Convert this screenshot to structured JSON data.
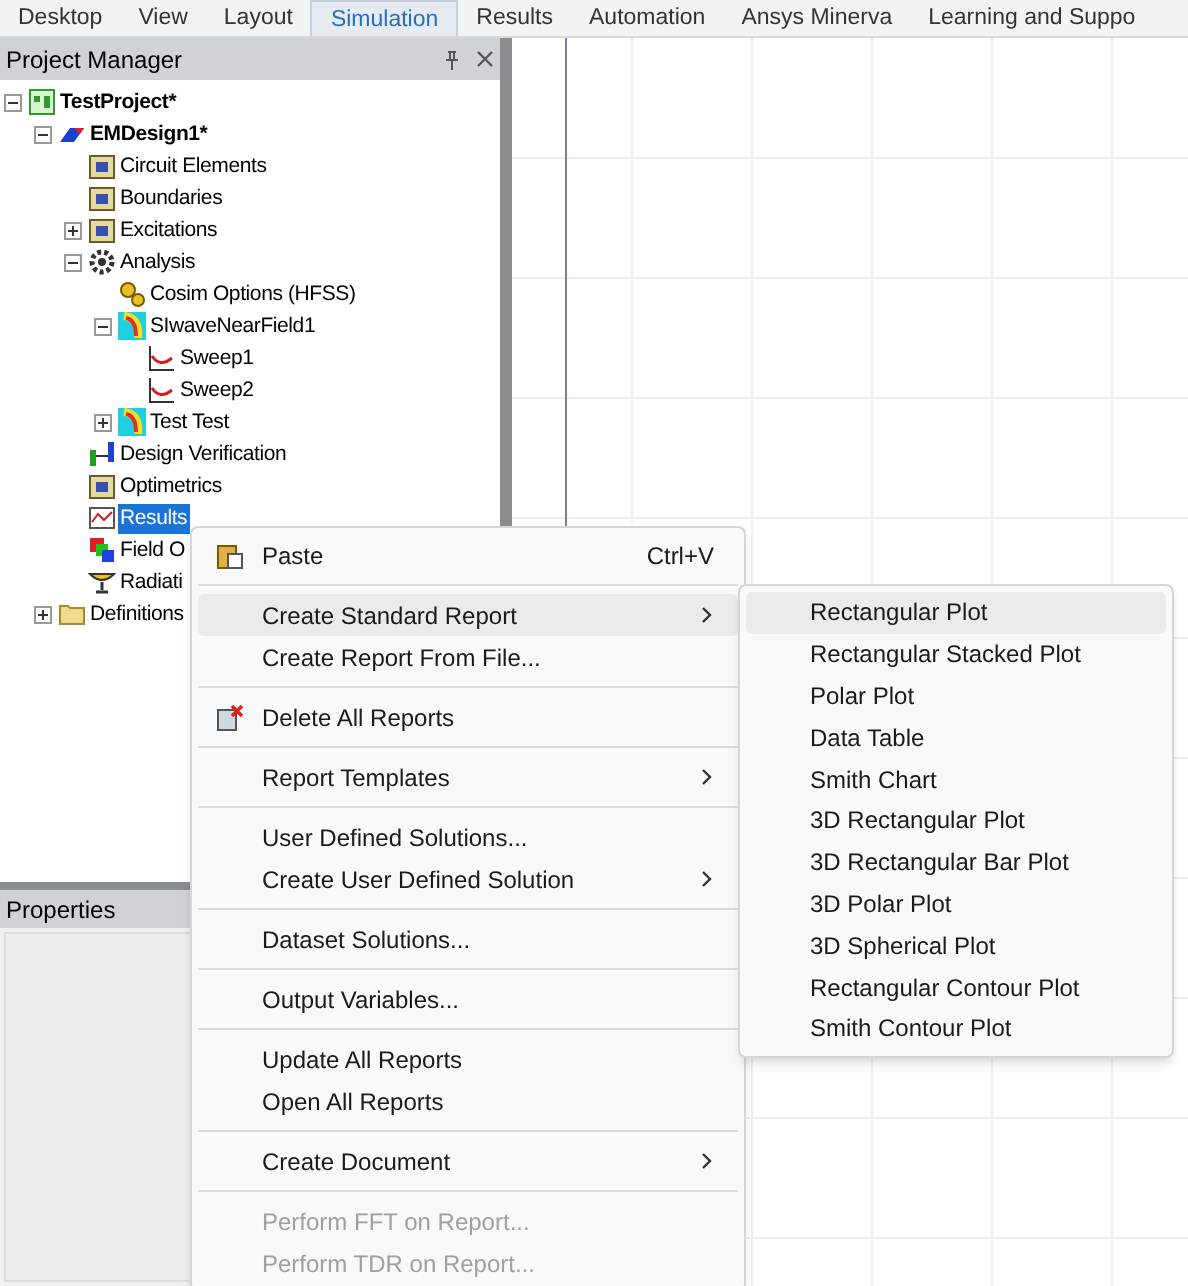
{
  "ribbon_tabs": [
    {
      "label": "Desktop",
      "selected": false
    },
    {
      "label": "View",
      "selected": false
    },
    {
      "label": "Layout",
      "selected": false
    },
    {
      "label": "Simulation",
      "selected": true
    },
    {
      "label": "Results",
      "selected": false
    },
    {
      "label": "Automation",
      "selected": false
    },
    {
      "label": "Ansys Minerva",
      "selected": false
    },
    {
      "label": "Learning and Suppo",
      "selected": false
    }
  ],
  "project_manager": {
    "title": "Project Manager",
    "tree": [
      {
        "label": "TestProject*",
        "kind": "project",
        "bold": true,
        "expanded": true,
        "selected": false,
        "children": [
          {
            "label": "EMDesign1*",
            "kind": "design",
            "bold": true,
            "expanded": true,
            "selected": false,
            "children": [
              {
                "label": "Circuit Elements",
                "kind": "folder",
                "bold": false,
                "selected": false
              },
              {
                "label": "Boundaries",
                "kind": "folder",
                "bold": false,
                "selected": false
              },
              {
                "label": "Excitations",
                "kind": "folder",
                "bold": false,
                "expanded": false,
                "selected": false
              },
              {
                "label": "Analysis",
                "kind": "gear",
                "bold": false,
                "expanded": true,
                "selected": false,
                "children": [
                  {
                    "label": "Cosim Options (HFSS)",
                    "kind": "gears",
                    "bold": false,
                    "selected": false
                  },
                  {
                    "label": "SIwaveNearField1",
                    "kind": "field",
                    "bold": false,
                    "expanded": true,
                    "selected": false,
                    "children": [
                      {
                        "label": "Sweep1",
                        "kind": "sweep",
                        "bold": false,
                        "selected": false
                      },
                      {
                        "label": "Sweep2",
                        "kind": "sweep",
                        "bold": false,
                        "selected": false
                      }
                    ]
                  },
                  {
                    "label": "Test Test",
                    "kind": "field",
                    "bold": false,
                    "expanded": false,
                    "selected": false
                  }
                ]
              },
              {
                "label": "Design Verification",
                "kind": "verify",
                "bold": false,
                "selected": false
              },
              {
                "label": "Optimetrics",
                "kind": "folder",
                "bold": false,
                "selected": false
              },
              {
                "label": "Results",
                "kind": "results",
                "bold": false,
                "selected": true
              },
              {
                "label": "Field O",
                "kind": "overlay",
                "bold": false,
                "selected": false
              },
              {
                "label": "Radiati",
                "kind": "radiation",
                "bold": false,
                "selected": false
              }
            ]
          },
          {
            "label": "Definitions",
            "kind": "plainfolder",
            "bold": false,
            "expanded": false,
            "selected": false
          }
        ]
      }
    ]
  },
  "properties": {
    "title": "Properties"
  },
  "context_menu": [
    {
      "kind": "item",
      "label": "Paste",
      "shortcut": "Ctrl+V",
      "selected": false,
      "disabled": false
    },
    {
      "kind": "separator"
    },
    {
      "kind": "submenu",
      "label": "Create Standard Report",
      "selected": true,
      "disabled": false
    },
    {
      "kind": "item",
      "label": "Create Report From File...",
      "selected": false,
      "disabled": false
    },
    {
      "kind": "separator"
    },
    {
      "kind": "item",
      "label": "Delete All Reports",
      "selected": false,
      "disabled": false
    },
    {
      "kind": "separator"
    },
    {
      "kind": "submenu",
      "label": "Report Templates",
      "selected": false,
      "disabled": false
    },
    {
      "kind": "separator"
    },
    {
      "kind": "item",
      "label": "User Defined Solutions...",
      "selected": false,
      "disabled": false
    },
    {
      "kind": "submenu",
      "label": "Create User Defined Solution",
      "selected": false,
      "disabled": false
    },
    {
      "kind": "separator"
    },
    {
      "kind": "item",
      "label": "Dataset Solutions...",
      "selected": false,
      "disabled": false
    },
    {
      "kind": "separator"
    },
    {
      "kind": "item",
      "label": "Output Variables...",
      "selected": false,
      "disabled": false
    },
    {
      "kind": "separator"
    },
    {
      "kind": "item",
      "label": "Update All Reports",
      "selected": false,
      "disabled": false
    },
    {
      "kind": "item",
      "label": "Open All Reports",
      "selected": false,
      "disabled": false
    },
    {
      "kind": "separator"
    },
    {
      "kind": "submenu",
      "label": "Create Document",
      "selected": false,
      "disabled": false
    },
    {
      "kind": "separator"
    },
    {
      "kind": "item",
      "label": "Perform FFT on Report...",
      "selected": false,
      "disabled": true
    },
    {
      "kind": "item",
      "label": "Perform TDR on Report...",
      "selected": false,
      "disabled": true
    }
  ],
  "submenu": [
    {
      "label": "Rectangular Plot",
      "selected": true
    },
    {
      "label": "Rectangular Stacked Plot",
      "selected": false
    },
    {
      "label": "Polar Plot",
      "selected": false
    },
    {
      "label": "Data Table",
      "selected": false
    },
    {
      "label": "Smith Chart",
      "selected": false
    },
    {
      "label": "3D Rectangular Plot",
      "selected": false
    },
    {
      "label": "3D Rectangular Bar Plot",
      "selected": false
    },
    {
      "label": "3D Polar Plot",
      "selected": false
    },
    {
      "label": "3D Spherical Plot",
      "selected": false
    },
    {
      "label": "Rectangular Contour Plot",
      "selected": false
    },
    {
      "label": "Smith Contour Plot",
      "selected": false
    }
  ]
}
